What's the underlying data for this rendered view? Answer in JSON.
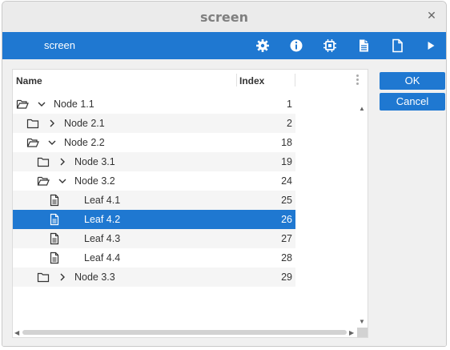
{
  "window": {
    "title": "screen"
  },
  "toolbar": {
    "title": "screen",
    "icons": [
      "gear-icon",
      "info-icon",
      "chip-icon",
      "document-text-icon",
      "document-icon",
      "play-icon"
    ]
  },
  "tree": {
    "columns": {
      "name": "Name",
      "index": "Index"
    },
    "rows": [
      {
        "label": "Node 1.1",
        "index": "1",
        "icon": "folder-open-icon",
        "chevron": "down",
        "level": 0
      },
      {
        "label": "Node 2.1",
        "index": "2",
        "icon": "folder-icon",
        "chevron": "right",
        "level": 1
      },
      {
        "label": "Node 2.2",
        "index": "18",
        "icon": "folder-open-icon",
        "chevron": "down",
        "level": 1
      },
      {
        "label": "Node 3.1",
        "index": "19",
        "icon": "folder-icon",
        "chevron": "right",
        "level": 2
      },
      {
        "label": "Node 3.2",
        "index": "24",
        "icon": "folder-open-icon",
        "chevron": "down",
        "level": 2
      },
      {
        "label": "Leaf 4.1",
        "index": "25",
        "icon": "document-icon",
        "chevron": "",
        "level": 3
      },
      {
        "label": "Leaf 4.2",
        "index": "26",
        "icon": "document-icon",
        "chevron": "",
        "level": 3,
        "selected": true
      },
      {
        "label": "Leaf 4.3",
        "index": "27",
        "icon": "document-icon",
        "chevron": "",
        "level": 3
      },
      {
        "label": "Leaf 4.4",
        "index": "28",
        "icon": "document-icon",
        "chevron": "",
        "level": 3
      },
      {
        "label": "Node 3.3",
        "index": "29",
        "icon": "folder-icon",
        "chevron": "right",
        "level": 2
      }
    ]
  },
  "buttons": {
    "ok": "OK",
    "cancel": "Cancel"
  },
  "colors": {
    "accent": "#1f78d1",
    "titlebar": "#ebebeb",
    "content_bg": "#f0f0f0"
  }
}
